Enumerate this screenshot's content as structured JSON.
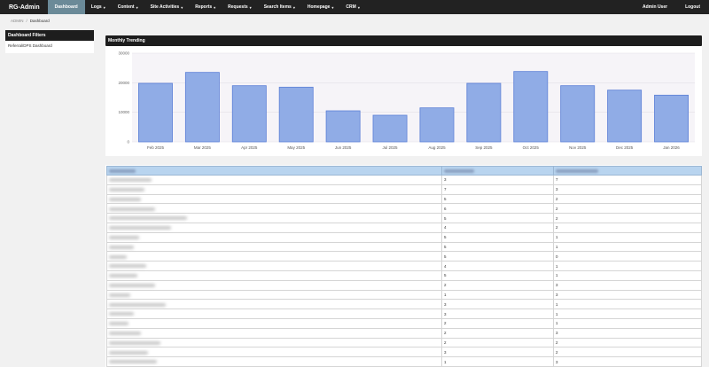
{
  "navbar": {
    "brand": "RG-Admin",
    "items": [
      {
        "label": "Dashboard",
        "active": true,
        "dropdown": false
      },
      {
        "label": "Logs",
        "dropdown": true
      },
      {
        "label": "Content",
        "dropdown": true
      },
      {
        "label": "Site Activities",
        "dropdown": true
      },
      {
        "label": "Reports",
        "dropdown": true
      },
      {
        "label": "Requests",
        "dropdown": true
      },
      {
        "label": "Search Items",
        "dropdown": true
      },
      {
        "label": "Homepage",
        "dropdown": true
      },
      {
        "label": "CRM",
        "dropdown": true
      }
    ],
    "user": "Admin User",
    "logout": "Logout"
  },
  "breadcrumb": {
    "root": "ADMIN",
    "sep": "/",
    "current": "Dashboard"
  },
  "sidebar": {
    "title": "Dashboard Filters",
    "items": [
      "Referral/DPS Dashboard"
    ]
  },
  "chart_panel": {
    "title": "Monthly Trending"
  },
  "chart_data": {
    "type": "bar",
    "categories": [
      "Feb 2025",
      "Mar 2025",
      "Apr 2025",
      "May 2025",
      "Jun 2025",
      "Jul 2025",
      "Aug 2025",
      "Sep 2025",
      "Oct 2025",
      "Nov 2025",
      "Dec 2025",
      "Jan 2026"
    ],
    "values": [
      19800,
      23500,
      19000,
      18500,
      10500,
      9000,
      11500,
      19800,
      23800,
      19000,
      17500,
      15800
    ],
    "yticks": [
      0,
      10000,
      20000,
      30000
    ],
    "ylim": [
      0,
      30000
    ],
    "grid": true,
    "bar_color": "#90ace6",
    "bar_border": "#5b7fd6"
  },
  "table": {
    "rows": [
      {
        "c2": "3",
        "c3": "7"
      },
      {
        "c2": "7",
        "c3": "3"
      },
      {
        "c2": "5",
        "c3": "2"
      },
      {
        "c2": "6",
        "c3": "2"
      },
      {
        "c2": "5",
        "c3": "2"
      },
      {
        "c2": "4",
        "c3": "2"
      },
      {
        "c2": "5",
        "c3": "1"
      },
      {
        "c2": "5",
        "c3": "1"
      },
      {
        "c2": "5",
        "c3": "0"
      },
      {
        "c2": "4",
        "c3": "1"
      },
      {
        "c2": "5",
        "c3": "1"
      },
      {
        "c2": "2",
        "c3": "3"
      },
      {
        "c2": "1",
        "c3": "3"
      },
      {
        "c2": "3",
        "c3": "1"
      },
      {
        "c2": "3",
        "c3": "1"
      },
      {
        "c2": "2",
        "c3": "1"
      },
      {
        "c2": "2",
        "c3": "3"
      },
      {
        "c2": "2",
        "c3": "2"
      },
      {
        "c2": "3",
        "c3": "2"
      },
      {
        "c2": "1",
        "c3": "3"
      }
    ]
  }
}
